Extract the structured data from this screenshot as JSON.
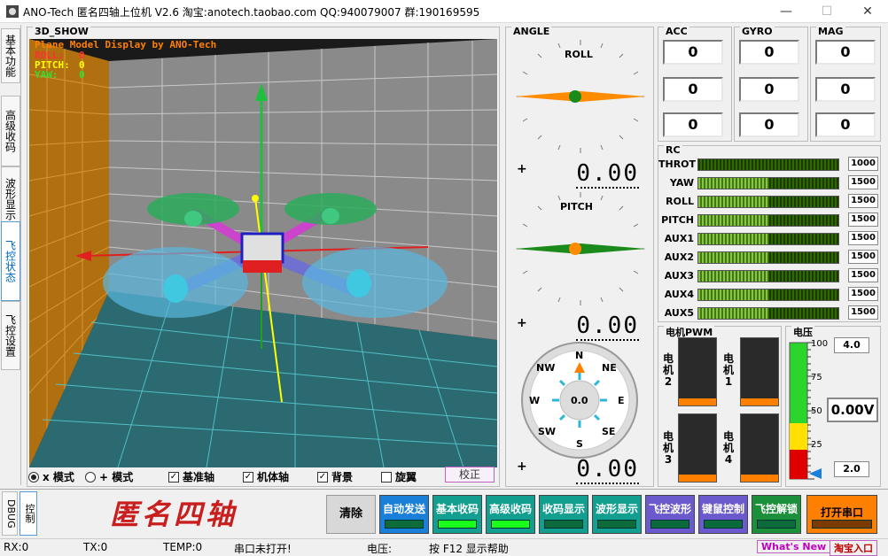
{
  "window": {
    "title": "ANO-Tech   匿名四轴上位机   V2.6   淘宝:anotech.taobao.com   QQ:940079007   群:190169595",
    "minimize": "—",
    "maximize": "☐",
    "close": "✕"
  },
  "left_tabs": [
    "基本功能",
    "高级收码",
    "波形显示",
    "飞控状态",
    "飞控设置"
  ],
  "show3d": {
    "label": "3D_SHOW",
    "overlay_title": "Plane Model Display by ANO-Tech",
    "roll_label": "ROLL:",
    "roll_value": "0",
    "pitch_label": "PITCH:",
    "pitch_value": "0",
    "yaw_label": "YAW:",
    "yaw_value": "0"
  },
  "view_options": {
    "x_mode": "x 模式",
    "plus_mode": "+ 模式",
    "base_axis": "基准轴",
    "body_axis": "机体轴",
    "background": "背景",
    "rotate": "旋翼",
    "calibrate": "校正"
  },
  "angle": {
    "label": "ANGLE",
    "roll_label": "ROLL",
    "pitch_label": "PITCH",
    "roll_sign": "+",
    "roll_value": "0.00",
    "pitch_sign": "+",
    "pitch_value": "0.00",
    "yaw_sign": "+",
    "yaw_value": "0.00",
    "compass": {
      "n": "N",
      "ne": "NE",
      "e": "E",
      "se": "SE",
      "s": "S",
      "sw": "SW",
      "w": "W",
      "nw": "NW",
      "value": "0.0"
    }
  },
  "sensors": {
    "acc_label": "ACC",
    "gyro_label": "GYRO",
    "mag_label": "MAG",
    "acc": [
      "0",
      "0",
      "0"
    ],
    "gyro": [
      "0",
      "0",
      "0"
    ],
    "mag": [
      "0",
      "0",
      "0"
    ]
  },
  "rc": {
    "label": "RC",
    "channels": [
      {
        "name": "THROT",
        "value": "1000",
        "level": 0.0
      },
      {
        "name": "YAW",
        "value": "1500",
        "level": 0.5
      },
      {
        "name": "ROLL",
        "value": "1500",
        "level": 0.5
      },
      {
        "name": "PITCH",
        "value": "1500",
        "level": 0.5
      },
      {
        "name": "AUX1",
        "value": "1500",
        "level": 0.5
      },
      {
        "name": "AUX2",
        "value": "1500",
        "level": 0.5
      },
      {
        "name": "AUX3",
        "value": "1500",
        "level": 0.5
      },
      {
        "name": "AUX4",
        "value": "1500",
        "level": 0.5
      },
      {
        "name": "AUX5",
        "value": "1500",
        "level": 0.5
      }
    ]
  },
  "motor": {
    "label": "电机PWM",
    "m2": "电机2",
    "m1": "电机1",
    "m3": "电机3",
    "m4": "电机4"
  },
  "voltage": {
    "label": "电压",
    "ticks": [
      "100",
      "75",
      "50",
      "25",
      "0"
    ],
    "max_value": "4.0",
    "current": "0.00V",
    "min_value": "2.0"
  },
  "bottom": {
    "debug_tab": "DBUG",
    "control_tab": "控制",
    "logo": "匿名四轴",
    "clear": "清除",
    "buttons": [
      "自动发送",
      "基本收码",
      "高级收码",
      "收码显示",
      "波形显示",
      "飞控波形",
      "键鼠控制",
      "飞控解锁"
    ],
    "open_port": "打开串口"
  },
  "status": {
    "rx": "RX:0",
    "tx": "TX:0",
    "temp": "TEMP:0",
    "port": "串口未打开!",
    "voltage": "电压:",
    "help": "按 F12 显示帮助",
    "whats_new": "What's New",
    "taobao": "淘宝入口"
  },
  "colors": {
    "teal_btn": "#139f8f",
    "blue_btn": "#1a7fd8",
    "purple_btn": "#6a5acd",
    "green_btn": "#1c8f3a",
    "orange_btn": "#ff7f00",
    "logo_red": "#c81e1e"
  }
}
